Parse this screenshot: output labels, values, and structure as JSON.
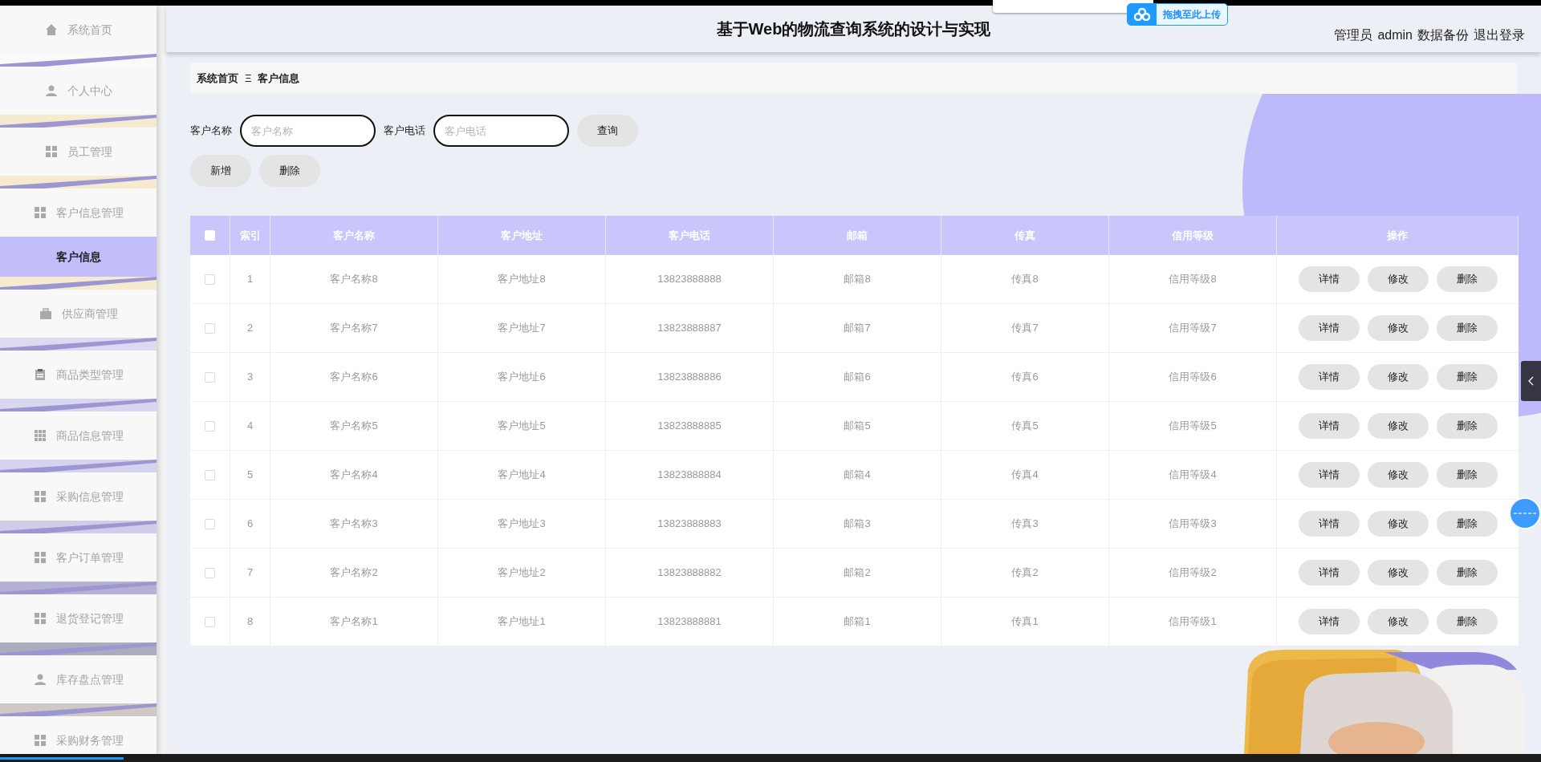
{
  "header": {
    "title": "基于Web的物流查询系统的设计与实现",
    "user_label": "管理员",
    "username": "admin",
    "links": [
      "数据备份",
      "退出登录"
    ]
  },
  "upload_popup": {
    "label": "拖拽至此上传"
  },
  "progress": {
    "level": 0.08
  },
  "sidebar": {
    "items": [
      {
        "label": "系统首页",
        "selected": false
      },
      {
        "label": "个人中心",
        "selected": false
      },
      {
        "label": "员工管理",
        "selected": false
      },
      {
        "label": "客户信息管理",
        "selected": false,
        "children": [
          {
            "label": "客户信息",
            "selected": true
          }
        ]
      },
      {
        "label": "供应商管理",
        "selected": false
      },
      {
        "label": "商品类型管理",
        "selected": false
      },
      {
        "label": "商品信息管理",
        "selected": false
      },
      {
        "label": "采购信息管理",
        "selected": false
      },
      {
        "label": "客户订单管理",
        "selected": false
      },
      {
        "label": "退货登记管理",
        "selected": false
      },
      {
        "label": "库存盘点管理",
        "selected": false
      },
      {
        "label": "采购财务管理",
        "selected": false
      }
    ]
  },
  "breadcrumb": {
    "items": [
      "系统首页",
      "客户信息"
    ],
    "separator": "Ξ"
  },
  "search": {
    "fields": [
      {
        "label": "客户名称",
        "placeholder": "客户名称"
      },
      {
        "label": "客户电话",
        "placeholder": "客户电话"
      }
    ],
    "button": "查询"
  },
  "actions": [
    "新增",
    "删除"
  ],
  "table": {
    "select_all": false,
    "columns": [
      "索引",
      "客户名称",
      "客户地址",
      "客户电话",
      "邮箱",
      "传真",
      "信用等级",
      "操作"
    ],
    "rows": [
      {
        "checked": false,
        "cells": [
          "1",
          "客户名称8",
          "客户地址8",
          "13823888888",
          "邮箱8",
          "传真8",
          "信用等级8"
        ],
        "actions": [
          "详情",
          "修改",
          "删除"
        ]
      },
      {
        "checked": false,
        "cells": [
          "2",
          "客户名称7",
          "客户地址7",
          "13823888887",
          "邮箱7",
          "传真7",
          "信用等级7"
        ],
        "actions": [
          "详情",
          "修改",
          "删除"
        ]
      },
      {
        "checked": false,
        "cells": [
          "3",
          "客户名称6",
          "客户地址6",
          "13823888886",
          "邮箱6",
          "传真6",
          "信用等级6"
        ],
        "actions": [
          "详情",
          "修改",
          "删除"
        ]
      },
      {
        "checked": false,
        "cells": [
          "4",
          "客户名称5",
          "客户地址5",
          "13823888885",
          "邮箱5",
          "传真5",
          "信用等级5"
        ],
        "actions": [
          "详情",
          "修改",
          "删除"
        ]
      },
      {
        "checked": false,
        "cells": [
          "5",
          "客户名称4",
          "客户地址4",
          "13823888884",
          "邮箱4",
          "传真4",
          "信用等级4"
        ],
        "actions": [
          "详情",
          "修改",
          "删除"
        ]
      },
      {
        "checked": false,
        "cells": [
          "6",
          "客户名称3",
          "客户地址3",
          "13823888883",
          "邮箱3",
          "传真3",
          "信用等级3"
        ],
        "actions": [
          "详情",
          "修改",
          "删除"
        ]
      },
      {
        "checked": false,
        "cells": [
          "7",
          "客户名称2",
          "客户地址2",
          "13823888882",
          "邮箱2",
          "传真2",
          "信用等级2"
        ],
        "actions": [
          "详情",
          "修改",
          "删除"
        ]
      },
      {
        "checked": false,
        "cells": [
          "8",
          "客户名称1",
          "客户地址1",
          "13823888881",
          "邮箱1",
          "传真1",
          "信用等级1"
        ],
        "actions": [
          "详情",
          "修改",
          "删除"
        ]
      }
    ]
  }
}
